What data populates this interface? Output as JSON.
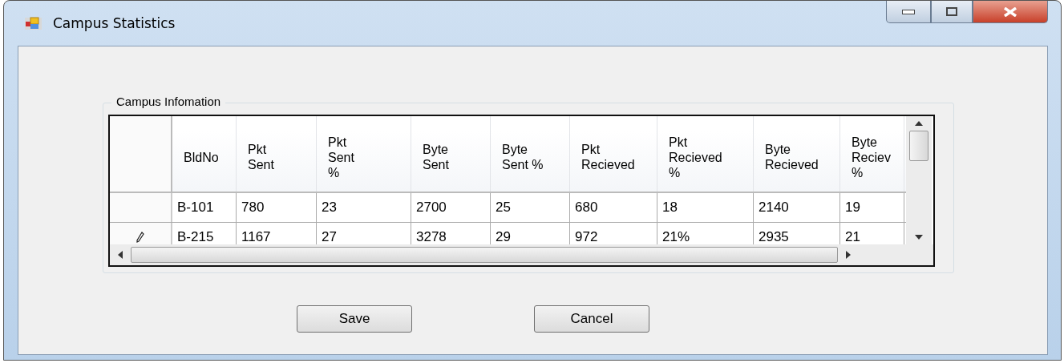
{
  "window": {
    "title": "Campus Statistics"
  },
  "group": {
    "title": "Campus Infomation"
  },
  "table": {
    "columns": [
      {
        "lines": [
          "BldNo"
        ]
      },
      {
        "lines": [
          "Pkt",
          "Sent"
        ]
      },
      {
        "lines": [
          "Pkt",
          "Sent",
          "%"
        ]
      },
      {
        "lines": [
          "Byte",
          "Sent"
        ]
      },
      {
        "lines": [
          "Byte",
          "Sent %"
        ]
      },
      {
        "lines": [
          "Pkt",
          "Recieved"
        ]
      },
      {
        "lines": [
          "Pkt",
          "Recieved",
          "%"
        ]
      },
      {
        "lines": [
          "Byte",
          "Recieved"
        ]
      },
      {
        "lines": [
          "Byte",
          "Reciev",
          "%"
        ]
      }
    ],
    "rows": [
      {
        "editing": false,
        "cells": [
          "B-101",
          "780",
          "23",
          "2700",
          "25",
          "680",
          "18",
          "2140",
          "19"
        ]
      },
      {
        "editing": true,
        "cells": [
          "B-215",
          "1167",
          "27",
          "3278",
          "29",
          "972",
          "21%",
          "2935",
          "21"
        ]
      }
    ]
  },
  "buttons": [
    "Save",
    "Cancel"
  ]
}
